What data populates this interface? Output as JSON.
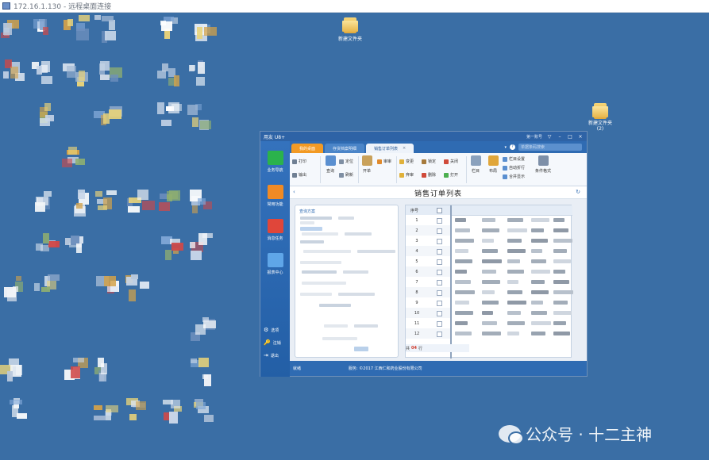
{
  "rdp": {
    "title": "172.16.1.130 - 远程桌面连接"
  },
  "desktop": {
    "folders": [
      {
        "label": "新建文件夹"
      },
      {
        "label": "新建文件夹\n(2)"
      }
    ]
  },
  "app": {
    "title": "用友 U8+",
    "user": "第一账号",
    "tabs": [
      {
        "label": "我的桌面"
      },
      {
        "label": "存货档案明细"
      },
      {
        "label": "销售订单列表",
        "close": "×"
      }
    ],
    "search_placeholder": "单据条码搜索",
    "ribbon": {
      "print": "打印",
      "export": "输出",
      "query": "查询",
      "locate": "定位",
      "refresh": "刷新",
      "bill": "开单",
      "approve": "审审",
      "unapprove": "弃审",
      "change": "变更",
      "close": "关闭",
      "open": "打开",
      "delete": "删除",
      "lock": "锁定",
      "unlock": "解锁",
      "settings": "栏目",
      "layout": "布局",
      "col_setting": "栏目设置",
      "auto_fold": "自动折行",
      "merge_show": "合并显示",
      "format": "条件格式"
    },
    "sidebar": [
      {
        "label": "业务导航"
      },
      {
        "label": "常用功能"
      },
      {
        "label": "消息任务"
      },
      {
        "label": "报表中心"
      }
    ],
    "sidebar_bottom": [
      {
        "icon": "⚙",
        "label": "选项"
      },
      {
        "icon": "🔑",
        "label": "注销"
      },
      {
        "icon": "⇥",
        "label": "退出"
      }
    ],
    "page_title": "销售订单列表",
    "query_title": "查询方案",
    "grid": {
      "seq_header": "序号",
      "rows": [
        "1",
        "2",
        "3",
        "4",
        "5",
        "6",
        "7",
        "8",
        "9",
        "10",
        "11",
        "12"
      ]
    },
    "pager": {
      "prefix": "共",
      "count": "04",
      "suffix": "行"
    },
    "status": {
      "left": "就绪",
      "right": "服务: ©2017 江西仁和药业股份有限公司"
    }
  },
  "watermark": {
    "text": "公众号 · 十二主神"
  }
}
